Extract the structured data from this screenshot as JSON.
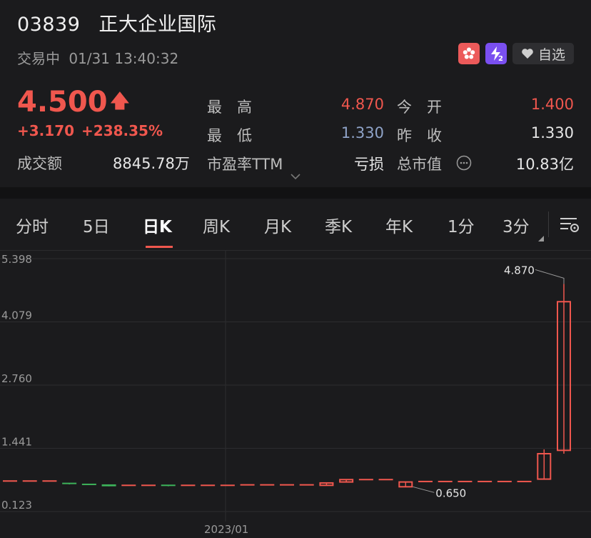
{
  "stock": {
    "code": "03839",
    "name": "正大企业国际",
    "status": "交易中",
    "timestamp": "01/31 13:40:32",
    "price": "4.500",
    "price_arrow": "🡅",
    "change": "+3.170",
    "change_pct": "+238.35%",
    "turnover_label": "成交额",
    "turnover_value": "8845.78万",
    "favorite_label": "自选"
  },
  "stats": {
    "high_label": "最　高",
    "high_value": "4.870",
    "open_label": "今　开",
    "open_value": "1.400",
    "low_label": "最　低",
    "low_value": "1.330",
    "prev_close_label": "昨　收",
    "prev_close_value": "1.330",
    "pe_label": "市盈率TTM",
    "pe_value": "亏损",
    "mktcap_label": "总市值",
    "mktcap_value": "10.83亿"
  },
  "tabs": [
    "分时",
    "5日",
    "日K",
    "周K",
    "月K",
    "季K",
    "年K",
    "1分",
    "3分"
  ],
  "active_tab": "日K",
  "colors": {
    "up": "#f0574e",
    "down": "#3db35a",
    "background": "#1b1b1d"
  },
  "icons": [
    "hk-flag-icon",
    "lv2-icon",
    "heart-icon",
    "info-icon",
    "chart-settings-icon"
  ],
  "chart_data": {
    "type": "candlestick",
    "y_ticks": [
      "5.398",
      "4.079",
      "2.760",
      "1.441",
      "0.123"
    ],
    "x_tick": "2023/01",
    "annotations": {
      "max": "4.870",
      "min": "0.650"
    },
    "ylim": [
      0.123,
      5.398
    ],
    "candles": [
      {
        "open": 0.76,
        "close": 0.76,
        "high": 0.76,
        "low": 0.76,
        "dir": "up"
      },
      {
        "open": 0.76,
        "close": 0.76,
        "high": 0.76,
        "low": 0.76,
        "dir": "up"
      },
      {
        "open": 0.76,
        "close": 0.76,
        "high": 0.76,
        "low": 0.76,
        "dir": "up"
      },
      {
        "open": 0.71,
        "close": 0.69,
        "high": 0.71,
        "low": 0.69,
        "dir": "down"
      },
      {
        "open": 0.69,
        "close": 0.68,
        "high": 0.69,
        "low": 0.68,
        "dir": "down"
      },
      {
        "open": 0.69,
        "close": 0.65,
        "high": 0.69,
        "low": 0.65,
        "dir": "down"
      },
      {
        "open": 0.67,
        "close": 0.67,
        "high": 0.67,
        "low": 0.67,
        "dir": "up"
      },
      {
        "open": 0.67,
        "close": 0.67,
        "high": 0.67,
        "low": 0.67,
        "dir": "up"
      },
      {
        "open": 0.67,
        "close": 0.66,
        "high": 0.67,
        "low": 0.65,
        "dir": "down"
      },
      {
        "open": 0.67,
        "close": 0.67,
        "high": 0.67,
        "low": 0.67,
        "dir": "up"
      },
      {
        "open": 0.67,
        "close": 0.67,
        "high": 0.67,
        "low": 0.67,
        "dir": "up"
      },
      {
        "open": 0.67,
        "close": 0.67,
        "high": 0.67,
        "low": 0.67,
        "dir": "up"
      },
      {
        "open": 0.68,
        "close": 0.68,
        "high": 0.68,
        "low": 0.68,
        "dir": "up"
      },
      {
        "open": 0.68,
        "close": 0.68,
        "high": 0.68,
        "low": 0.68,
        "dir": "up"
      },
      {
        "open": 0.68,
        "close": 0.68,
        "high": 0.68,
        "low": 0.68,
        "dir": "up"
      },
      {
        "open": 0.68,
        "close": 0.68,
        "high": 0.68,
        "low": 0.68,
        "dir": "up"
      },
      {
        "open": 0.67,
        "close": 0.72,
        "high": 0.72,
        "low": 0.67,
        "dir": "up"
      },
      {
        "open": 0.74,
        "close": 0.79,
        "high": 0.8,
        "low": 0.74,
        "dir": "up"
      },
      {
        "open": 0.79,
        "close": 0.79,
        "high": 0.79,
        "low": 0.79,
        "dir": "up"
      },
      {
        "open": 0.79,
        "close": 0.79,
        "high": 0.79,
        "low": 0.79,
        "dir": "up"
      },
      {
        "open": 0.64,
        "close": 0.74,
        "high": 0.74,
        "low": 0.64,
        "dir": "up"
      },
      {
        "open": 0.75,
        "close": 0.75,
        "high": 0.75,
        "low": 0.75,
        "dir": "up"
      },
      {
        "open": 0.75,
        "close": 0.75,
        "high": 0.75,
        "low": 0.75,
        "dir": "up"
      },
      {
        "open": 0.75,
        "close": 0.75,
        "high": 0.75,
        "low": 0.75,
        "dir": "up"
      },
      {
        "open": 0.75,
        "close": 0.75,
        "high": 0.75,
        "low": 0.75,
        "dir": "up"
      },
      {
        "open": 0.75,
        "close": 0.75,
        "high": 0.75,
        "low": 0.75,
        "dir": "up"
      },
      {
        "open": 0.75,
        "close": 0.75,
        "high": 0.75,
        "low": 0.75,
        "dir": "up"
      },
      {
        "open": 0.8,
        "close": 1.33,
        "high": 1.42,
        "low": 0.8,
        "dir": "up"
      },
      {
        "open": 1.4,
        "close": 4.5,
        "high": 4.87,
        "low": 1.33,
        "dir": "up"
      }
    ]
  }
}
